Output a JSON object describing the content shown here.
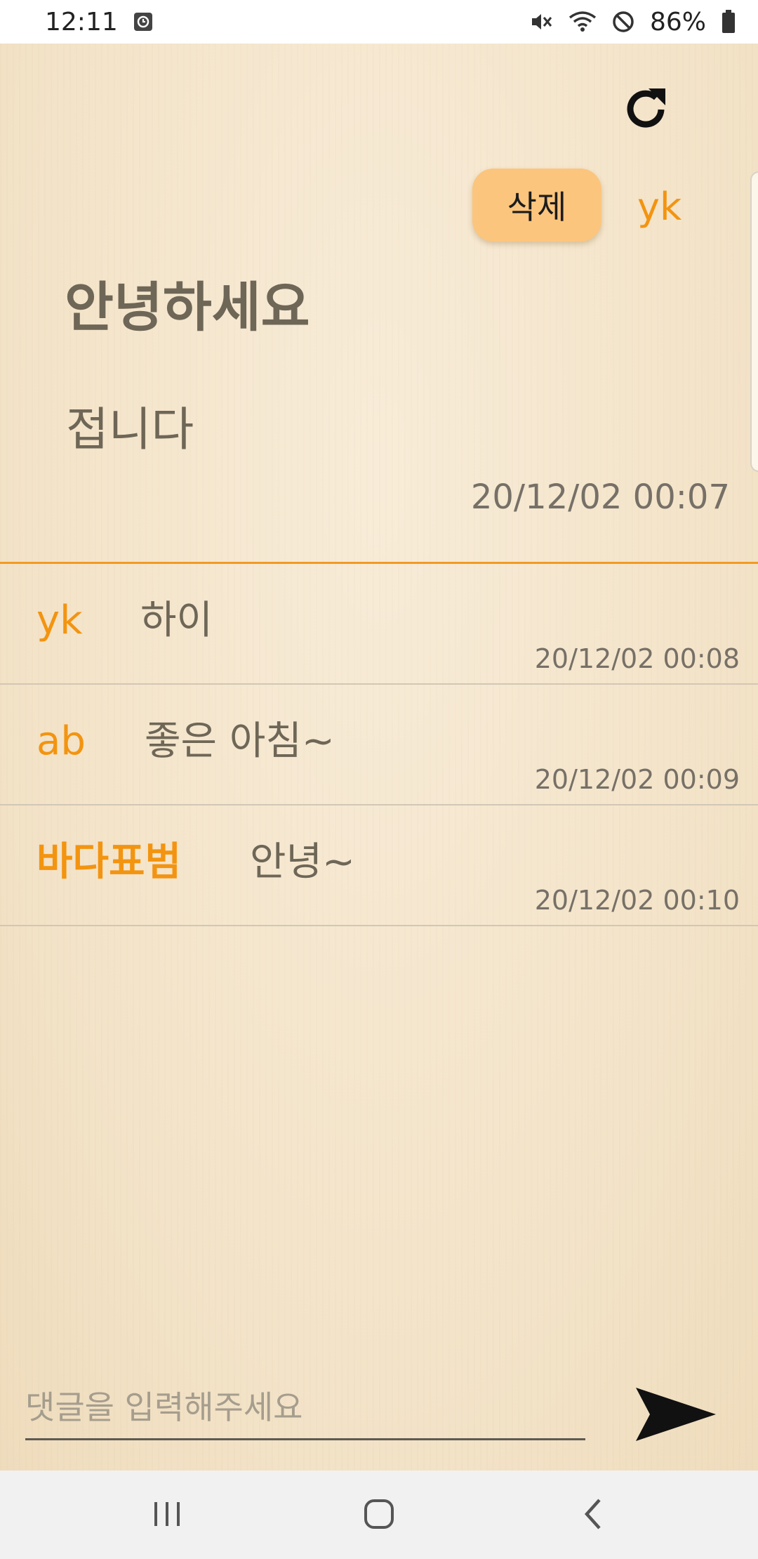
{
  "status_bar": {
    "time": "12:11",
    "battery": "86%",
    "icons": [
      "alarm-icon",
      "mute-icon",
      "wifi-icon",
      "do-not-disturb-icon",
      "battery-icon"
    ]
  },
  "post": {
    "delete_label": "삭제",
    "author": "yk",
    "title": "안녕하세요",
    "body": "접니다",
    "date": "20/12/02 00:07"
  },
  "comments": [
    {
      "author": "yk",
      "text": "하이",
      "time": "20/12/02 00:08"
    },
    {
      "author": "ab",
      "text": "좋은 아침~",
      "time": "20/12/02 00:09"
    },
    {
      "author": "바다표범",
      "text": "안녕~",
      "time": "20/12/02 00:10"
    }
  ],
  "comment_input": {
    "placeholder": "댓글을 입력해주세요",
    "value": ""
  },
  "colors": {
    "accent": "#f39410",
    "delete_button": "#fcc57d",
    "paper": "#f5e8d2"
  },
  "nav": {
    "icons": [
      "recent-apps-icon",
      "home-icon",
      "back-icon"
    ]
  }
}
